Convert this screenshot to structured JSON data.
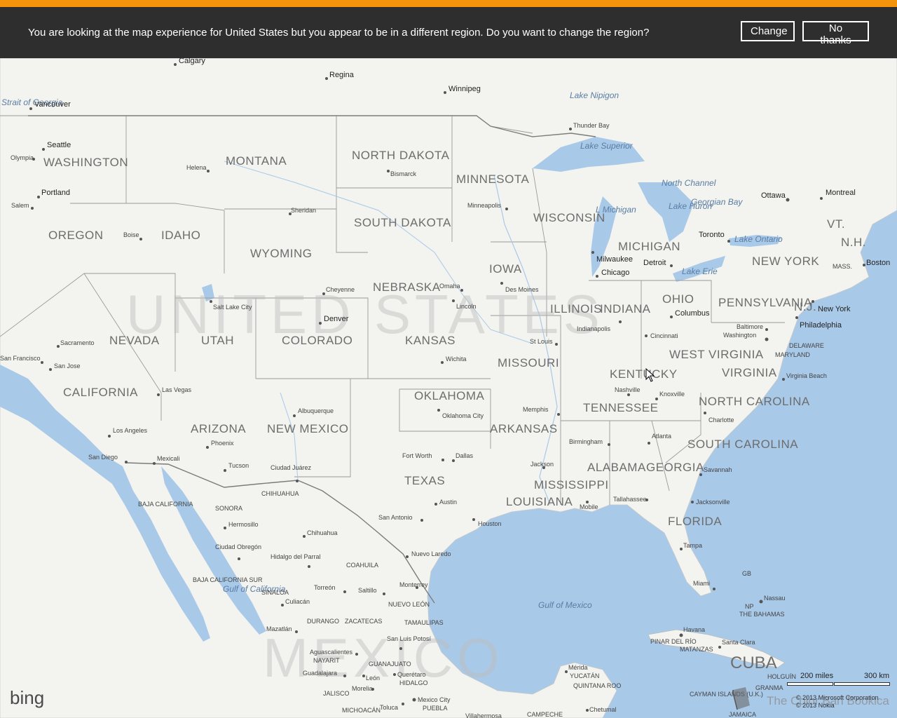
{
  "banner": {
    "message": "You are looking at the map experience for United States but you appear to be in a different region. Do you want to change the region?",
    "change_label": "Change",
    "no_thanks_label": "No thanks",
    "accent_color": "#f4940c",
    "background_color": "#2e2e2e"
  },
  "map": {
    "land_color": "#f4f4f1",
    "water_color": "#a9c9e8",
    "countries": [
      "UNITED STATES",
      "MEXICO",
      "CUBA"
    ],
    "states": [
      "MONTANA",
      "NORTH DAKOTA",
      "MINNESOTA",
      "WASHINGTON",
      "SOUTH DAKOTA",
      "WISCONSIN",
      "OREGON",
      "IDAHO",
      "WYOMING",
      "MICHIGAN",
      "IOWA",
      "NEW YORK",
      "NEBRASKA",
      "ILLINOIS",
      "INDIANA",
      "OHIO",
      "PENNSYLVANIA",
      "NEVADA",
      "UTAH",
      "COLORADO",
      "KANSAS",
      "MISSOURI",
      "WEST VIRGINIA",
      "VIRGINIA",
      "CALIFORNIA",
      "KENTUCKY",
      "OKLAHOMA",
      "NORTH CAROLINA",
      "TENNESSEE",
      "ARIZONA",
      "NEW MEXICO",
      "ARKANSAS",
      "SOUTH CAROLINA",
      "ALABAMA",
      "GEORGIA",
      "TEXAS",
      "MISSISSIPPI",
      "LOUISIANA",
      "FLORIDA",
      "VT.",
      "N.H.",
      "N.J.",
      "MASS."
    ],
    "cities": [
      "Calgary",
      "Regina",
      "Winnipeg",
      "Vancouver",
      "Seattle",
      "Olympia",
      "Helena",
      "Bismarck",
      "Thunder Bay",
      "Portland",
      "Salem",
      "Minneapolis",
      "Ottawa",
      "Montreal",
      "Sheridan",
      "Boise",
      "Milwaukee",
      "Toronto",
      "Detroit",
      "Boston",
      "Chicago",
      "Cheyenne",
      "Omaha",
      "Des Moines",
      "Salt Lake City",
      "Lincoln",
      "Denver",
      "Columbus",
      "New York",
      "Philadelphia",
      "Baltimore",
      "Washington",
      "Indianapolis",
      "Cincinnati",
      "Sacramento",
      "San Francisco",
      "San Jose",
      "St Louis",
      "Wichita",
      "Virginia Beach",
      "Nashville",
      "Knoxville",
      "Las Vegas",
      "Memphis",
      "Charlotte",
      "Albuquerque",
      "Oklahoma City",
      "Los Angeles",
      "Phoenix",
      "Atlanta",
      "Birmingham",
      "Fort Worth",
      "Dallas",
      "San Diego",
      "Mexicali",
      "Tucson",
      "Ciudad Juárez",
      "Jackson",
      "Savannah",
      "Tallahassee",
      "Mobile",
      "Jacksonville",
      "Austin",
      "San Antonio",
      "Houston",
      "Hermosillo",
      "Chihuahua",
      "Tampa",
      "Ciudad Obregón",
      "Nuevo Laredo",
      "Hidalgo del Parral",
      "Miami",
      "Torreón",
      "Saltillo",
      "Monterrey",
      "Nassau",
      "Culiacán",
      "Mazatlán",
      "Havana",
      "Santa Clara",
      "San Luis Potosí",
      "Aguascalientes",
      "Mérida",
      "Guadalajara",
      "León",
      "Querétaro",
      "Morelia",
      "Mexico City",
      "Toluca",
      "Chetumal"
    ],
    "water_labels": [
      "Lake Nipigon",
      "Lake Superior",
      "North Channel",
      "Georgian Bay",
      "Lake Huron",
      "Lake Ontario",
      "Lake Erie",
      "L Michigan",
      "Strait of Georgia",
      "Gulf of Mexico",
      "Gulf of California"
    ],
    "regions": [
      "CHIHUAHUA",
      "SONORA",
      "BAJA CALIFORNIA",
      "BAJA CALIFORNIA SUR",
      "SINALOA",
      "COAHUILA",
      "NUEVO LEÓN",
      "TAMAULIPAS",
      "DURANGO",
      "ZACATECAS",
      "NAYARIT",
      "GUANAJUATO",
      "HIDALGO",
      "JALISCO",
      "MICHOACÁN",
      "PUEBLA",
      "YUCATÁN",
      "QUINTANA ROO",
      "CAMPECHE",
      "PINAR DEL RÍO",
      "MATANZAS",
      "HOLGUÍN",
      "GRANMA",
      "JAMAICA",
      "CAYMAN ISLANDS (U.K.)",
      "THE BAHAMAS",
      "NP",
      "GB",
      "DELAWARE",
      "MARYLAND",
      "Villahermosa"
    ]
  },
  "footer": {
    "logo": "bing",
    "scale_miles": "200 miles",
    "scale_km": "300 km",
    "copyright_1": "© 2013 Microsoft Corporation",
    "copyright_2": "© 2013 Nokia",
    "watermark": "The Color Ban Bookica"
  }
}
